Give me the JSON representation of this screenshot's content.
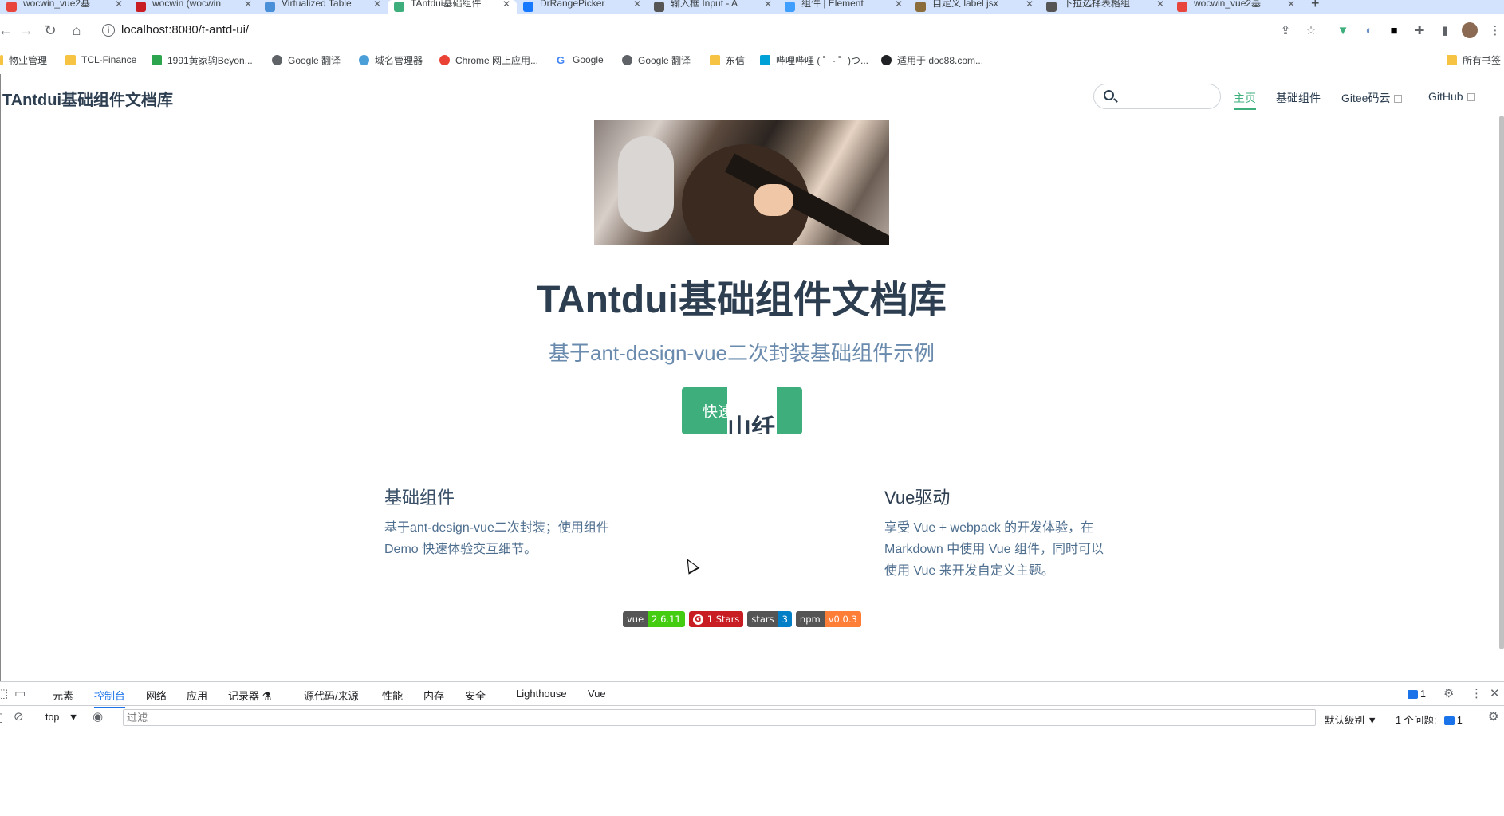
{
  "browser": {
    "tabs": [
      {
        "title": "wocwin_vue2基",
        "color": "#e8453c"
      },
      {
        "title": "wocwin (wocwin",
        "color": "#c71d23"
      },
      {
        "title": "Virtualized Table",
        "color": "#4a90d9"
      },
      {
        "title": "TAntdui基础组件",
        "color": "#3eaf7c"
      },
      {
        "title": "DrRangePicker",
        "color": "#1677ff"
      },
      {
        "title": "输入框 Input - A",
        "color": "#555555"
      },
      {
        "title": "组件 | Element",
        "color": "#409eff"
      },
      {
        "title": "自定义 label jsx",
        "color": "#8a6d3b"
      },
      {
        "title": "下拉选择表格组",
        "color": "#555555"
      },
      {
        "title": "wocwin_vue2基",
        "color": "#e8453c"
      }
    ],
    "active_tab_index": 3,
    "url": "localhost:8080/t-antd-ui/",
    "bookmarks": [
      {
        "label": "物业管理",
        "color": "#f6c342"
      },
      {
        "label": "TCL-Finance",
        "color": "#f6c342"
      },
      {
        "label": "1991黄家驹Beyon...",
        "color": "#2da44e"
      },
      {
        "label": "Google 翻译",
        "color": "#5f6368"
      },
      {
        "label": "域名管理器",
        "color": "#4a9fd8"
      },
      {
        "label": "Chrome 网上应用...",
        "color": "#ea4335"
      },
      {
        "label": "Google",
        "color": "#4285f4"
      },
      {
        "label": "Google 翻译",
        "color": "#5f6368"
      },
      {
        "label": "东信",
        "color": "#f6c342"
      },
      {
        "label": "哔哩哔哩 ( ゜- ゜)つ...",
        "color": "#00a1d6"
      },
      {
        "label": "适用于 doc88.com...",
        "color": "#202124"
      }
    ],
    "bookmarks_right": "所有书签"
  },
  "site": {
    "title": "TAntdui基础组件文档库",
    "search_placeholder": "",
    "nav": [
      {
        "label": "主页",
        "active": true,
        "external": false
      },
      {
        "label": "基础组件",
        "active": false,
        "external": false
      },
      {
        "label": "Gitee码云",
        "active": false,
        "external": true
      },
      {
        "label": "GitHub",
        "active": false,
        "external": true
      }
    ]
  },
  "hero": {
    "title": "TAntdui基础组件文档库",
    "description": "基于ant-design-vue二次封装基础组件示例",
    "action_label": "快速",
    "glitch_text": "山纤"
  },
  "features": [
    {
      "title": "基础组件",
      "details": "基于ant-design-vue二次封装；使用组件 Demo 快速体验交互细节。"
    },
    {
      "title": "Vue驱动",
      "details": "享受 Vue + webpack 的开发体验，在 Markdown 中使用 Vue 组件，同时可以使用 Vue 来开发自定义主题。"
    }
  ],
  "badges": [
    {
      "label": "vue",
      "value": "2.6.11",
      "color": "#4c1"
    },
    {
      "label": "",
      "value": "1 Stars",
      "color": "#c71d23"
    },
    {
      "label": "stars",
      "value": "3",
      "color": "#007ec6"
    },
    {
      "label": "npm",
      "value": "v0.0.3",
      "color": "#fe7d37"
    }
  ],
  "devtools": {
    "tabs": [
      "元素",
      "控制台",
      "网络",
      "应用",
      "记录器 ⚗",
      "源代码/来源",
      "性能",
      "内存",
      "安全",
      "Lighthouse",
      "Vue"
    ],
    "active_tab": "控制台",
    "issue_count_badge": "1",
    "context": "top",
    "filter_placeholder": "过滤",
    "level_label": "默认级别",
    "issues_label": "1 个问题:",
    "issues_count": "1"
  }
}
